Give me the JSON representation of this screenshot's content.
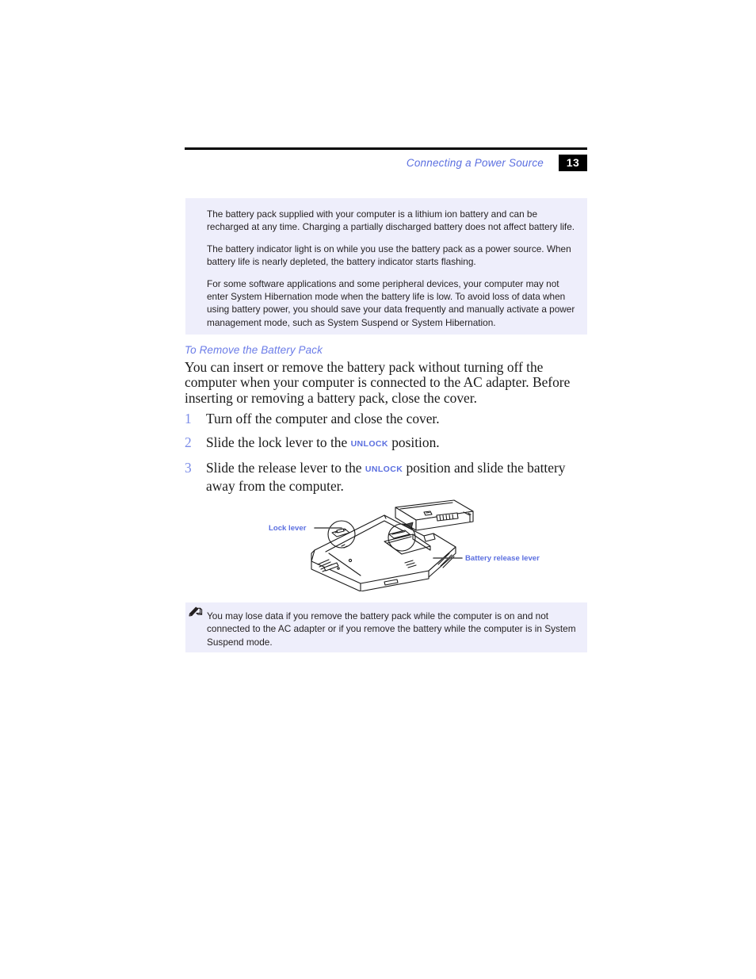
{
  "header": {
    "title": "Connecting a Power Source",
    "page_number": "13"
  },
  "note_top": {
    "paragraphs": [
      "The battery pack supplied with your computer is a lithium ion battery and can be recharged at any time. Charging a partially discharged battery does not affect battery life.",
      "The battery indicator light is on while you use the battery pack as a power source. When battery life is nearly depleted, the battery indicator starts flashing.",
      "For some software applications and some peripheral devices, your computer may not enter System Hibernation mode when the battery life is low. To avoid loss of data when using battery power, you should save your data frequently and manually activate a power management mode, such as System Suspend or System Hibernation."
    ]
  },
  "section": {
    "heading": "To Remove the Battery Pack",
    "intro": "You can insert or remove the battery pack without turning off the computer when your computer is connected to the AC adapter. Before inserting or removing a battery pack, close the cover."
  },
  "steps": [
    {
      "number": "1",
      "text_before": "Turn off the computer and close the cover.",
      "smallcaps": "",
      "text_after": ""
    },
    {
      "number": "2",
      "text_before": "Slide the lock lever to the ",
      "smallcaps": "UNLOCK",
      "text_after": " position."
    },
    {
      "number": "3",
      "text_before": "Slide the release lever to the ",
      "smallcaps": "UNLOCK",
      "text_after": " position and slide the battery away from the computer."
    }
  ],
  "illustration": {
    "callout_left": "Lock lever",
    "callout_right": "Battery release lever"
  },
  "note_bottom": {
    "icon": "pencil-note-icon",
    "text": "You may lose data if you remove the battery pack while the computer is on and not connected to the AC adapter or if you remove the battery while the computer is in System Suspend mode."
  },
  "colors": {
    "accent_blue": "#5b6fe0",
    "heading_blue": "#6b7ce8",
    "note_background": "#eeeefb",
    "badge_background": "#000000",
    "body_text": "#1a1a1a"
  }
}
